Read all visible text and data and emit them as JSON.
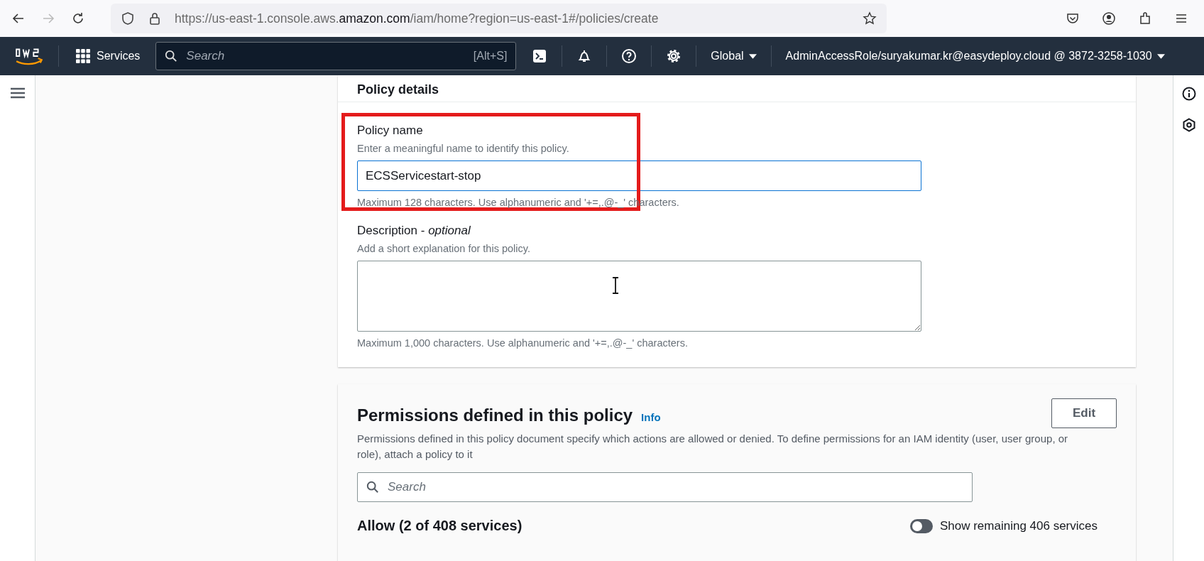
{
  "browser": {
    "forward_disabled": true,
    "url_start": "https://us-east-1.console.aws.",
    "url_domain": "amazon.com",
    "url_end": "/iam/home?region=us-east-1#/policies/create"
  },
  "top_nav": {
    "services": "Services",
    "search_placeholder": "Search",
    "shortcut": "[Alt+S]",
    "region": "Global",
    "account": "AdminAccessRole/suryakumar.kr@easydeploy.cloud @ 3872-3258-1030"
  },
  "policy_details": {
    "title": "Policy details",
    "policy_name": {
      "label": "Policy name",
      "hint": "Enter a meaningful name to identify this policy.",
      "value": "ECSServicestart-stop",
      "constraint": "Maximum 128 characters. Use alphanumeric and '+=,.@-_' characters.",
      "highlighted": true
    },
    "description": {
      "label": "Description - *optional*",
      "hint": "Add a short explanation for this policy.",
      "constraint": "Maximum 1,000 characters. Use alphanumeric and '+=,.@-_' characters."
    }
  },
  "permissions": {
    "title": "Permissions defined in this policy",
    "info_link": "Info",
    "edit_button": "Edit",
    "description": "Permissions defined in this policy document specify which actions are allowed or denied. To define permissions for an IAM identity (user, user group, or role), attach a policy to it",
    "search_placeholder": "Search",
    "allow_heading": "Allow (2 of 408 services)",
    "show_remaining": {
      "label": "Show remaining 406 services",
      "on": false
    }
  }
}
